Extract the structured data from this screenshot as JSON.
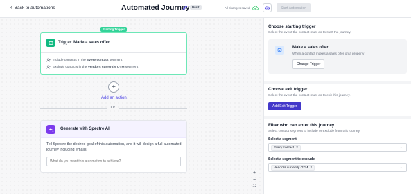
{
  "header": {
    "back_label": "Back to automations",
    "title": "Automated Journey",
    "status_badge": "Draft",
    "save_status": "All changes saved",
    "start_button": "Start Automation"
  },
  "canvas": {
    "trigger_badge": "Starting Trigger",
    "trigger_prefix": "Trigger:",
    "trigger_name": "Made a sales offer",
    "include_prefix": "Include contacts in the",
    "include_segment": "Every contact",
    "include_suffix": "segment",
    "exclude_prefix": "Exclude contacts in the",
    "exclude_segment": "Vendors currently OTM",
    "exclude_suffix": "segment",
    "add_action": "Add an action",
    "or_text": "Or",
    "spectre_title": "Generate with Spectre AI",
    "spectre_desc": "Tell Spectre the desired goal of this automation, and it will design a full automated journey including emails.",
    "spectre_placeholder": "What do you want this automation to achieve?",
    "zoom_in": "+",
    "zoom_out": "−",
    "fit": "⛶"
  },
  "panel": {
    "start_title": "Choose starting trigger",
    "start_sub": "Select the event the contact must do to start the journey.",
    "sales_title": "Make a sales offer",
    "sales_desc": "When a contact makes a sales offer on a property",
    "change_trigger": "Change Trigger",
    "exit_title": "Choose exit trigger",
    "exit_sub": "Select the event the contact must do to exit this journey.",
    "exit_button": "Add Exit Trigger",
    "filter_title": "Filter who can enter this journey",
    "filter_sub": "Select contact segment to include or exclude from this journey.",
    "segment_label": "Select a segment",
    "segment_value": "Every contact",
    "exclude_label": "Select a segment to exclude",
    "exclude_value": "Vendors currently OTM"
  },
  "colors": {
    "accent_green": "#10b981",
    "accent_indigo": "#4338ca",
    "accent_purple": "#7c3aed"
  }
}
